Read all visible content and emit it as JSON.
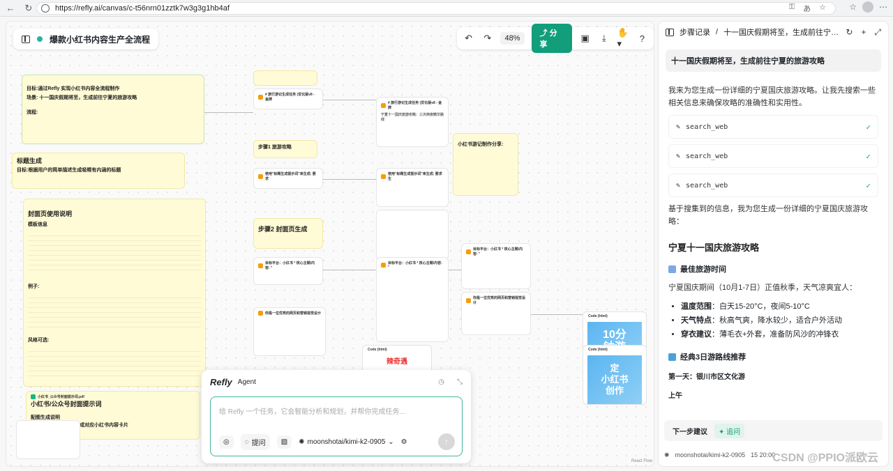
{
  "browser": {
    "url": "https://refly.ai/canvas/c-t56nrn01zztk7w3g3g1hb4af"
  },
  "canvas": {
    "title": "爆款小红书内容生产全流程",
    "toolbar": {
      "zoom": "48%",
      "share": "分享"
    },
    "nodes": {
      "goal_title": "目标:通过Refly 实现小红书内容全流程制作",
      "goal_scene": "场景: 十一国庆假期将至，生成前往宁夏的旅游攻略",
      "goal_flow": "流程:",
      "title_gen": "标题生成",
      "title_gen_desc": "目标:根据用户的简单描述生成吸睛有内涵的标题",
      "cover_title": "封面页使用说明",
      "cover_info": "模板信息",
      "cover_example": "例子:",
      "cover_style": "风格可选:",
      "step1": "步骤1 旅游攻略",
      "step2": "步骤2 封面页生成",
      "skill1": "# 旅行游记生成任务 (优化版v8 - 金牌",
      "skill2": "# 旅行游记生成任务 (优化版v8 - 金牌",
      "skill2_desc": "宁夏十一国庆旅游攻略：三天两夜精华路线",
      "skill3": "使用\"标题生成提示词\"来生成; 要求",
      "skill4": "使用\"标题生成提示词\"来生成; 要求生",
      "share_title": "小红书游记制作分享:",
      "cover1": "目标平台：小红书 * 核心主题/内容: \"",
      "cover2": "目标平台：小红书 * 核心主题/内容: \"",
      "cover3": "目标平台：小红书 * 核心主题/内容: \"",
      "webgen1": "你是一位优秀的网页和营销视觉设计",
      "webgen2": "你是一位优秀的网页和营销视觉设计",
      "pdf_label": "小红书_公众号封面提示词.pdf",
      "pdf_title": "小红书/公众号封面提示词",
      "auto_title": "配图生成说明",
      "auto_desc": "内容和图片链接自动生成对应小红书内容卡片",
      "code_label": "Code (html)",
      "card1_line1": "10分",
      "card1_line2": "钟游",
      "card2_line1": "定",
      "card2_line2": "小红书",
      "card2_line3": "创作",
      "card3_text": "辣奇遇"
    },
    "agent": {
      "logo": "Refly",
      "label": "Agent",
      "placeholder": "给 Refly 一个任务，它会智能分析和规划，并帮你完成任务...",
      "ask": "提问",
      "model": "moonshotai/kimi-k2-0905"
    },
    "react_flow": "React Flow"
  },
  "panel": {
    "breadcrumb": "步骤记录",
    "title": "十一国庆假期将至，生成前往宁夏的旅游攻略",
    "question": "十一国庆假期将至，生成前往宁夏的旅游攻略",
    "intro": "我来为您生成一份详细的宁夏国庆旅游攻略。让我先搜索一些相关信息来确保攻略的准确性和实用性。",
    "tools": [
      "search_web",
      "search_web",
      "search_web"
    ],
    "after_search": "基于搜集到的信息，我为您生成一份详细的宁夏国庆旅游攻略：",
    "guide_title": "宁夏十一国庆旅游攻略",
    "best_time": "最佳旅游时间",
    "best_time_desc": "宁夏国庆期间（10月1-7日）正值秋季，天气凉爽宜人：",
    "bullets": [
      {
        "k": "温度范围",
        "v": "：白天15-20°C，夜间5-10°C"
      },
      {
        "k": "天气特点",
        "v": "：秋高气爽，降水较少，适合户外活动"
      },
      {
        "k": "穿衣建议",
        "v": "：薄毛衣+外套，准备防风沙的冲锋衣"
      }
    ],
    "route_title": "经典3日游路线推荐",
    "day1": "第一天：银川市区文化游",
    "morning": "上午",
    "next_step": "下一步建议",
    "next_tag": "追问",
    "footer_model": "moonshotai/kimi-k2-0905",
    "footer_time": "15 20:00",
    "watermark": "CSDN @PPIO派欧云"
  }
}
